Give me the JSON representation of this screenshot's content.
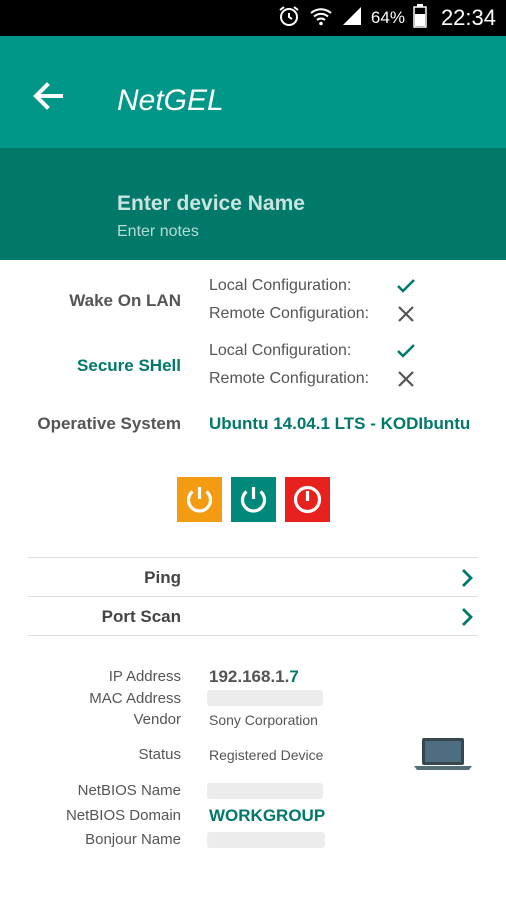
{
  "status_bar": {
    "icons": [
      "alarm-icon",
      "wifi-icon",
      "signal-icon",
      "battery-icon"
    ],
    "battery_percent": "64%",
    "time": "22:34"
  },
  "app_bar": {
    "title": "NetGEL"
  },
  "device": {
    "name_placeholder": "Enter device Name",
    "notes_placeholder": "Enter notes"
  },
  "services": [
    {
      "label": "Wake On LAN",
      "local": "Local Configuration:",
      "local_ok": true,
      "remote": "Remote Configuration:",
      "remote_ok": false
    },
    {
      "label": "Secure SHell",
      "local": "Local Configuration:",
      "local_ok": true,
      "remote": "Remote Configuration:",
      "remote_ok": false
    }
  ],
  "os": {
    "label": "Operative System",
    "value": "Ubuntu 14.04.1 LTS - KODIbuntu"
  },
  "power_buttons": [
    "power-orange",
    "power-teal",
    "power-red"
  ],
  "actions": {
    "ping": "Ping",
    "port_scan": "Port Scan"
  },
  "info": {
    "ip_label": "IP Address",
    "ip_prefix": "192.168.1.",
    "ip_suffix": "7",
    "mac_label": "MAC Address",
    "vendor_label": "Vendor",
    "vendor_value": "Sony Corporation",
    "status_label": "Status",
    "status_value": "Registered Device",
    "netbios_name_label": "NetBIOS Name",
    "netbios_domain_label": "NetBIOS Domain",
    "netbios_domain_value": "WORKGROUP",
    "bonjour_label": "Bonjour Name"
  },
  "colors": {
    "primary": "#009688",
    "primary_dark": "#00796b",
    "orange": "#f39c12",
    "red": "#e8211e"
  }
}
